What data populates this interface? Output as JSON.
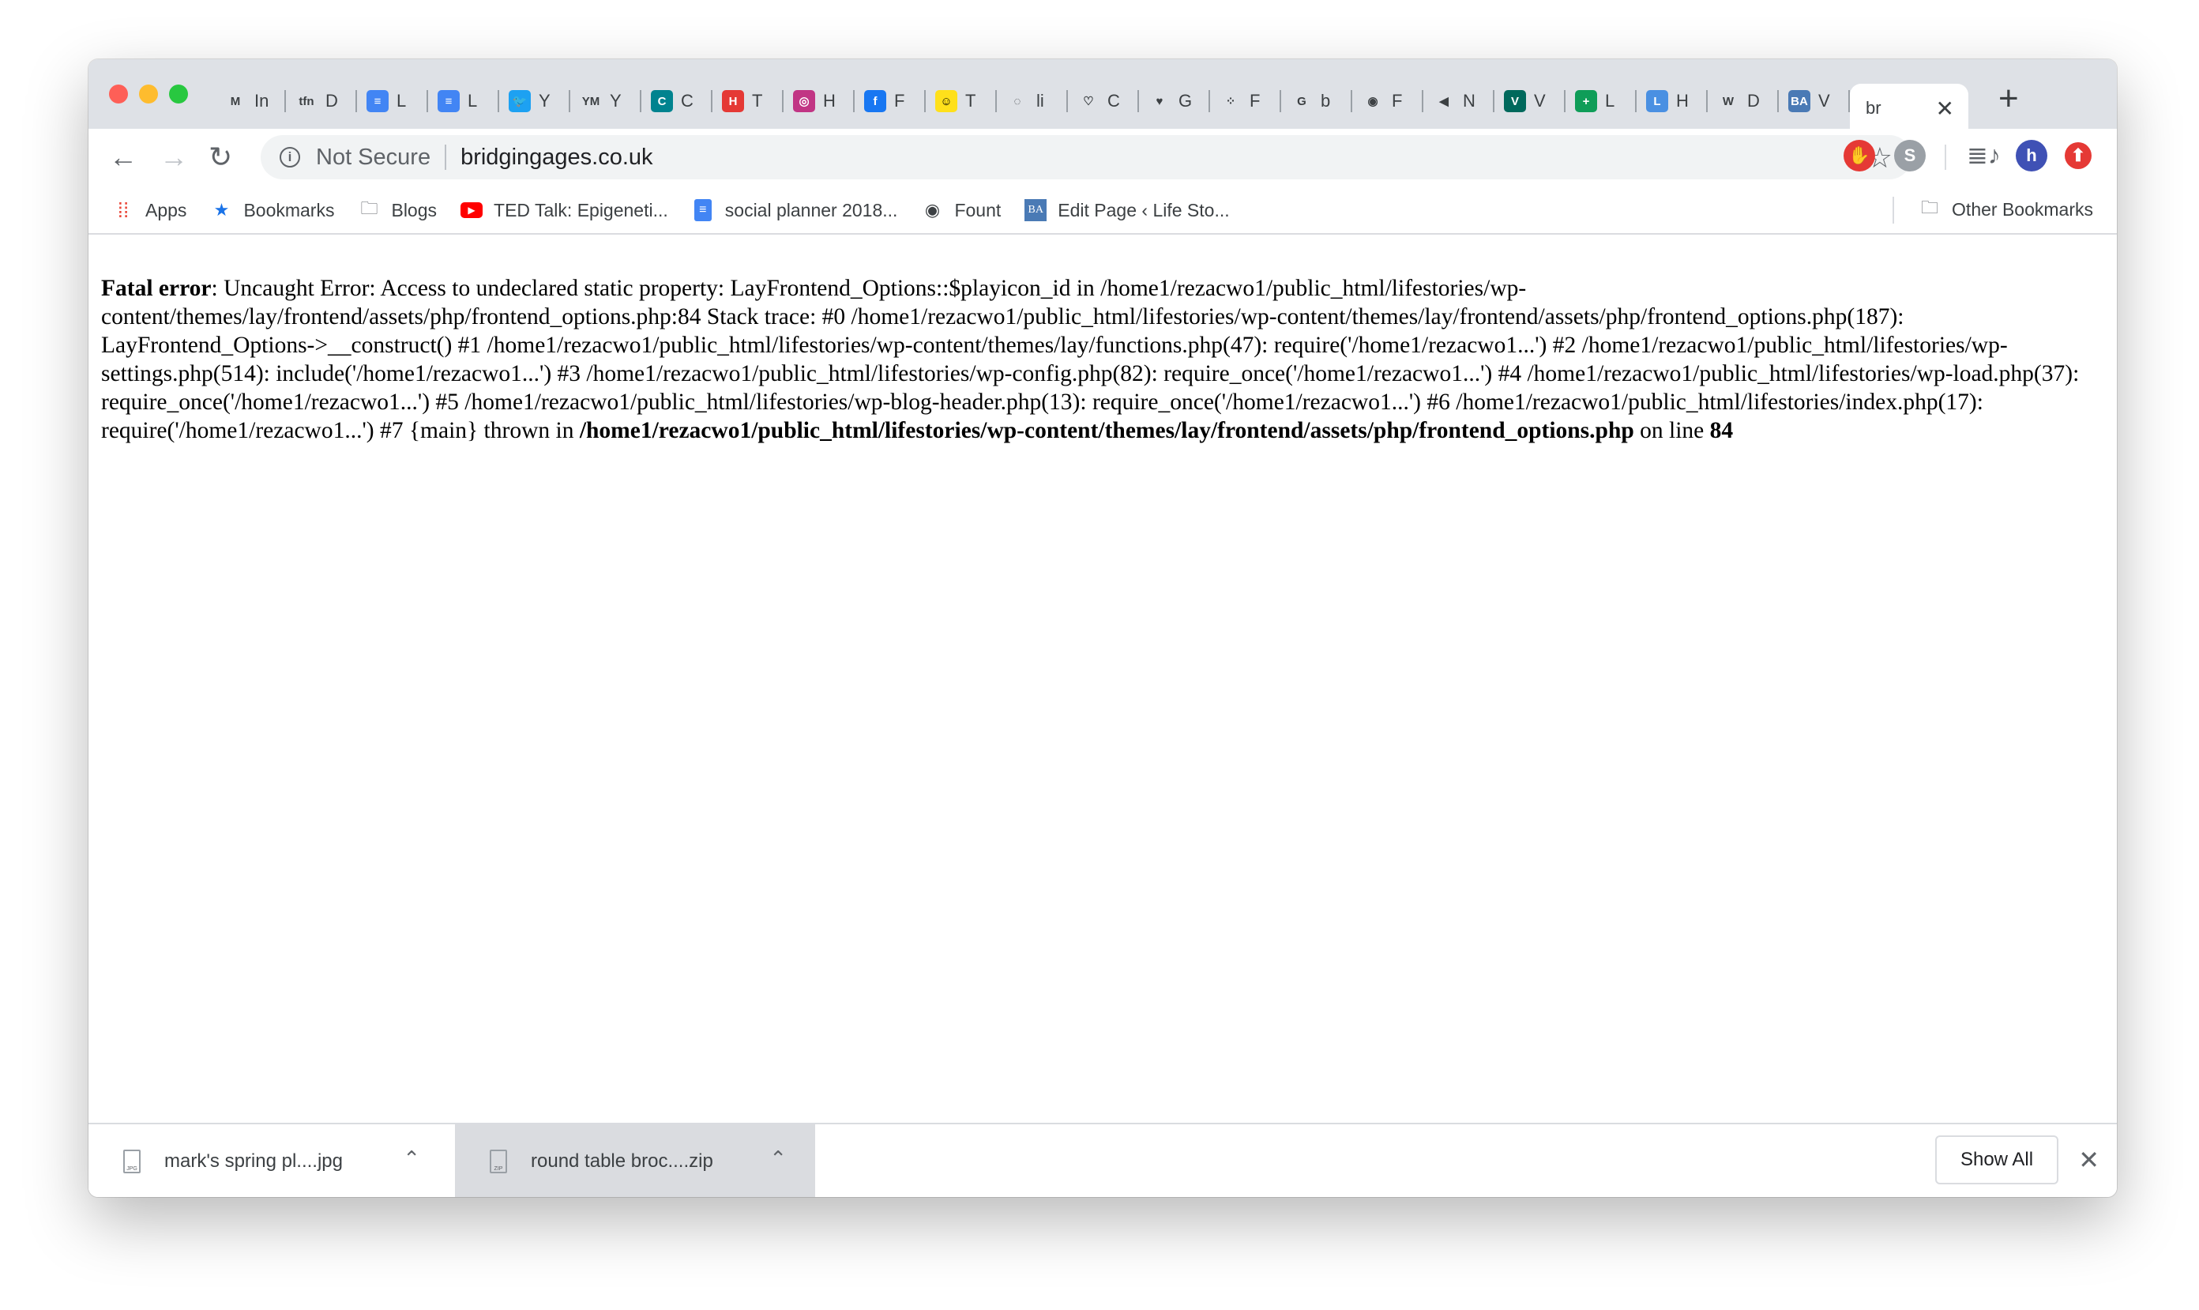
{
  "tabs": [
    {
      "icon": "gmail-icon",
      "label": "In",
      "color": "#ffffff",
      "text": "M"
    },
    {
      "icon": "tfn-icon",
      "label": "D",
      "color": "#ffffff",
      "text": "tfn"
    },
    {
      "icon": "docs-icon",
      "label": "L",
      "color": "#4285f4",
      "text": "≡"
    },
    {
      "icon": "docs-icon",
      "label": "L",
      "color": "#4285f4",
      "text": "≡"
    },
    {
      "icon": "twitter-icon",
      "label": "Y",
      "color": "#1da1f2",
      "text": "🐦"
    },
    {
      "icon": "ym-icon",
      "label": "Y",
      "color": "#ffffff",
      "text": "YM"
    },
    {
      "icon": "c-icon",
      "label": "C",
      "color": "#00838f",
      "text": "C"
    },
    {
      "icon": "h-icon",
      "label": "T",
      "color": "#e53935",
      "text": "H"
    },
    {
      "icon": "instagram-icon",
      "label": "H",
      "color": "#c13584",
      "text": "◎"
    },
    {
      "icon": "facebook-icon",
      "label": "F",
      "color": "#1877f2",
      "text": "f"
    },
    {
      "icon": "mailchimp-icon",
      "label": "T",
      "color": "#ffe01b",
      "text": "☺"
    },
    {
      "icon": "loading-icon",
      "label": "li",
      "color": "#ffffff",
      "text": "◌"
    },
    {
      "icon": "pocket-icon",
      "label": "C",
      "color": "#ffffff",
      "text": "♡"
    },
    {
      "icon": "pocket-icon",
      "label": "G",
      "color": "#ffffff",
      "text": "♥"
    },
    {
      "icon": "grid-icon",
      "label": "F",
      "color": "#ffffff",
      "text": "⁘"
    },
    {
      "icon": "google-icon",
      "label": "b",
      "color": "#ffffff",
      "text": "G"
    },
    {
      "icon": "globe-icon",
      "label": "F",
      "color": "#ffffff",
      "text": "◉"
    },
    {
      "icon": "audio-icon",
      "label": "N",
      "color": "#ffffff",
      "text": "◀"
    },
    {
      "icon": "v-icon",
      "label": "V",
      "color": "#00695c",
      "text": "V"
    },
    {
      "icon": "sheets-icon",
      "label": "L",
      "color": "#0f9d58",
      "text": "+"
    },
    {
      "icon": "l-icon",
      "label": "H",
      "color": "#4a90e2",
      "text": "L"
    },
    {
      "icon": "wordpress-icon",
      "label": "D",
      "color": "#ffffff",
      "text": "W"
    },
    {
      "icon": "ba-icon",
      "label": "V",
      "color": "#4a7ab5",
      "text": "BA"
    }
  ],
  "active_tab": {
    "label": "br",
    "close": "✕"
  },
  "new_tab": "+",
  "toolbar": {
    "not_secure": "Not Secure",
    "url": "bridgingages.co.uk"
  },
  "bookmarks": [
    {
      "icon": "apps-icon",
      "label": "Apps"
    },
    {
      "icon": "star-icon",
      "label": "Bookmarks"
    },
    {
      "icon": "folder-icon",
      "label": "Blogs"
    },
    {
      "icon": "youtube-icon",
      "label": "TED Talk: Epigeneti..."
    },
    {
      "icon": "docs-icon",
      "label": "social planner 2018..."
    },
    {
      "icon": "globe-icon",
      "label": "Fount"
    },
    {
      "icon": "ba-icon",
      "label": "Edit Page ‹ Life Sto..."
    }
  ],
  "other_bookmarks": "Other Bookmarks",
  "error": {
    "heading": "Fatal error",
    "message": ": Uncaught Error: Access to undeclared static property: LayFrontend_Options::$playicon_id in /home1/rezacwo1/public_html/lifestories/wp-content/themes/lay/frontend/assets/php/frontend_options.php:84 Stack trace: #0 /home1/rezacwo1/public_html/lifestories/wp-content/themes/lay/frontend/assets/php/frontend_options.php(187): LayFrontend_Options->__construct() #1 /home1/rezacwo1/public_html/lifestories/wp-content/themes/lay/functions.php(47): require('/home1/rezacwo1...') #2 /home1/rezacwo1/public_html/lifestories/wp-settings.php(514): include('/home1/rezacwo1...') #3 /home1/rezacwo1/public_html/lifestories/wp-config.php(82): require_once('/home1/rezacwo1...') #4 /home1/rezacwo1/public_html/lifestories/wp-load.php(37): require_once('/home1/rezacwo1...') #5 /home1/rezacwo1/public_html/lifestories/wp-blog-header.php(13): require_once('/home1/rezacwo1...') #6 /home1/rezacwo1/public_html/lifestories/index.php(17): require('/home1/rezacwo1...') #7 {main} thrown in ",
    "file": "/home1/rezacwo1/public_html/lifestories/wp-content/themes/lay/frontend/assets/php/frontend_options.php",
    "on_line": " on line ",
    "line": "84"
  },
  "downloads": [
    {
      "name": "mark's spring pl....jpg",
      "icon_label": "JPG"
    },
    {
      "name": "round table broc....zip",
      "icon_label": "ZIP"
    }
  ],
  "show_all": "Show All",
  "extensions": [
    {
      "icon": "adblock-icon",
      "color": "#e53935",
      "text": "✋"
    },
    {
      "icon": "skype-icon",
      "color": "#9aa0a6",
      "text": "S"
    },
    {
      "icon": "avatar",
      "color": "#3f51b5",
      "text": "h"
    },
    {
      "icon": "upload-icon",
      "color": "#e53935",
      "text": "⬆"
    }
  ]
}
